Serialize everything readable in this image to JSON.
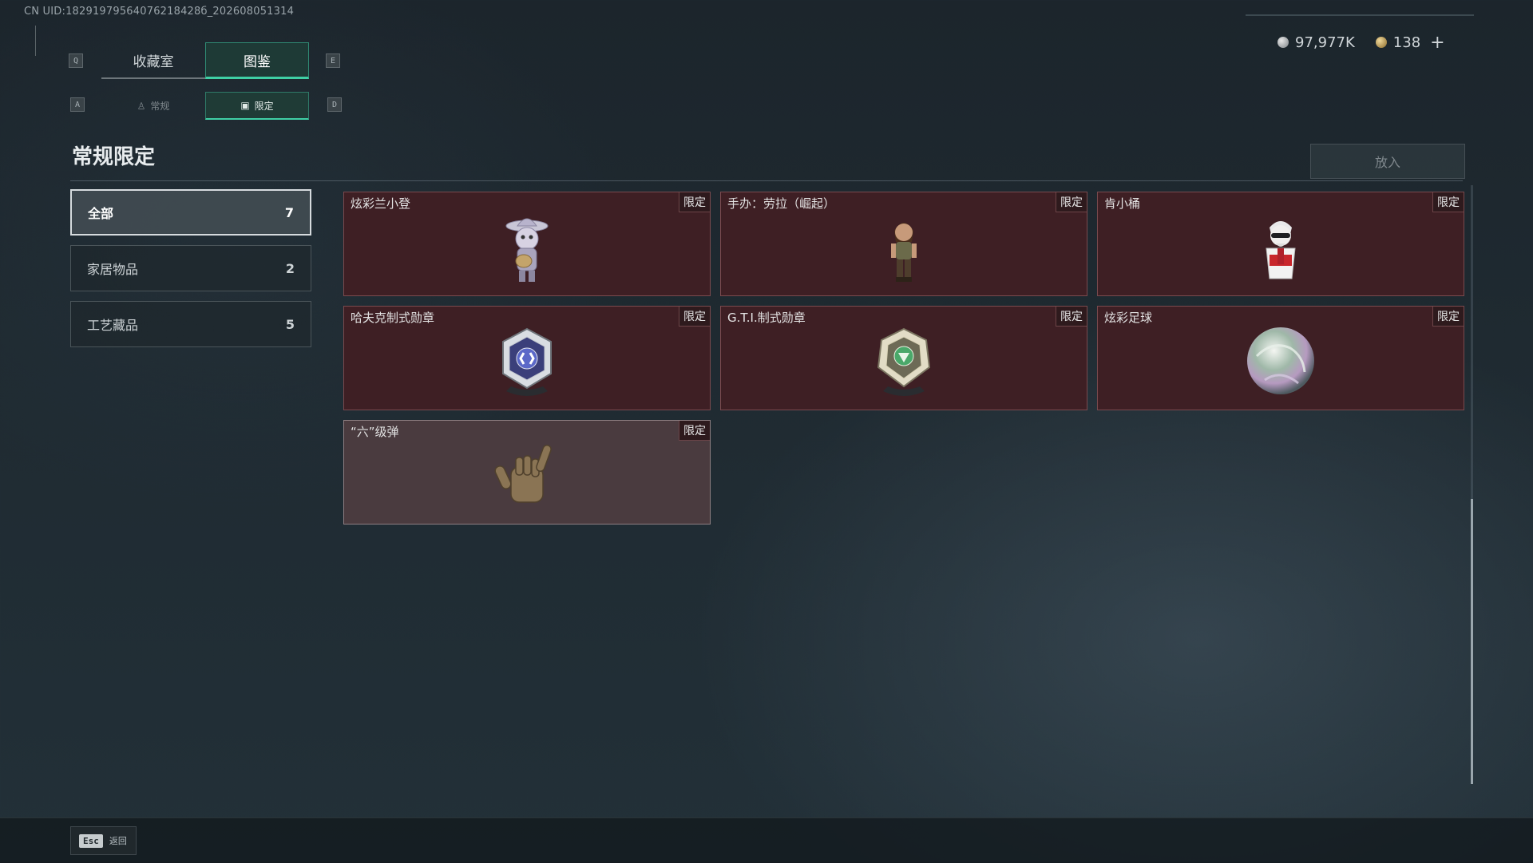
{
  "header": {
    "uid": "CN UID:18291979564076218428б_202608051314",
    "currency": [
      {
        "icon": "silver-coin-icon",
        "value": "97,977K"
      },
      {
        "icon": "gold-coin-icon",
        "value": "138"
      }
    ],
    "plus_label": "+"
  },
  "tabs": {
    "key_left": "Q",
    "key_right": "E",
    "items": [
      {
        "label": "收藏室",
        "active": false
      },
      {
        "label": "图鉴",
        "active": true
      }
    ]
  },
  "subtabs": {
    "key_left": "A",
    "key_right": "D",
    "items": [
      {
        "label": "常规",
        "icon": "figure-icon",
        "active": false
      },
      {
        "label": "限定",
        "icon": "image-icon",
        "active": true
      }
    ]
  },
  "section": {
    "title": "常规限定",
    "put_button": "放入"
  },
  "categories": [
    {
      "label": "全部",
      "count": "7",
      "selected": true
    },
    {
      "label": "家居物品",
      "count": "2",
      "selected": false
    },
    {
      "label": "工艺藏品",
      "count": "5",
      "selected": false
    }
  ],
  "items": [
    {
      "name": "炫彩兰小登",
      "badge": "限定",
      "icon": "mariachi-doll-icon"
    },
    {
      "name": "手办：劳拉（崛起）",
      "badge": "限定",
      "icon": "lara-figure-icon"
    },
    {
      "name": "肯小桶",
      "badge": "限定",
      "icon": "colonel-bucket-figure-icon"
    },
    {
      "name": "哈夫克制式勋章",
      "badge": "限定",
      "icon": "haavk-medal-icon"
    },
    {
      "name": "G.T.I.制式勋章",
      "badge": "限定",
      "icon": "gti-medal-icon"
    },
    {
      "name": "炫彩足球",
      "badge": "限定",
      "icon": "iridescent-football-icon"
    },
    {
      "name": "“六”级弹",
      "badge": "限定",
      "icon": "shaka-hand-icon"
    }
  ],
  "footer": {
    "esc_key": "Esc",
    "esc_label": "返回"
  }
}
